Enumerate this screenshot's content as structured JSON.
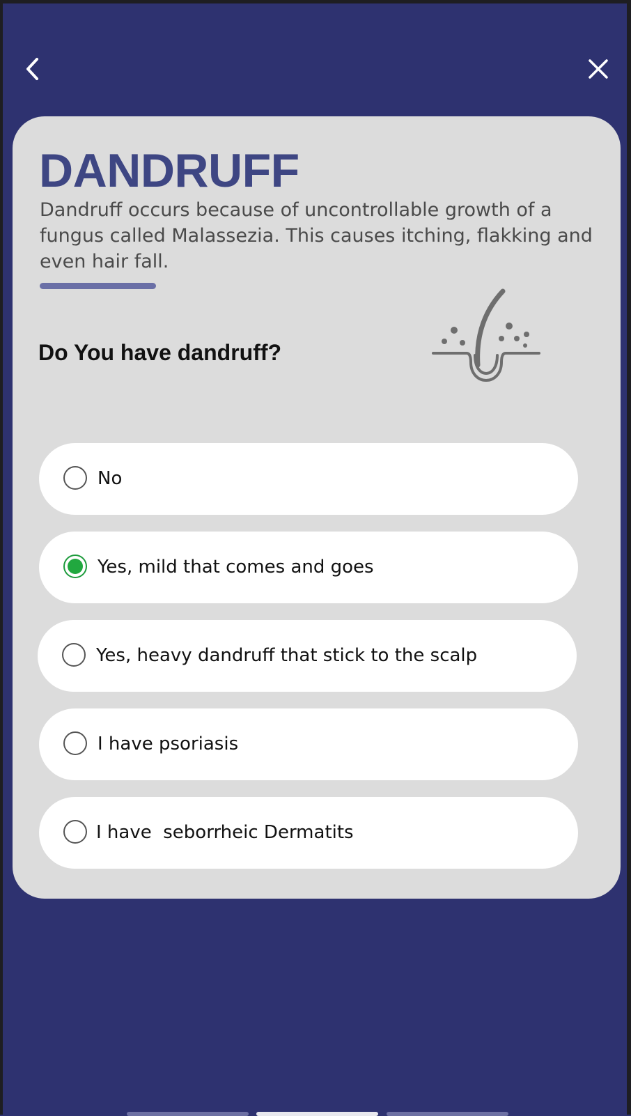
{
  "header": {
    "back_icon": "chevron-left-icon",
    "close_icon": "close-icon"
  },
  "card": {
    "title": "DANDRUFF",
    "description": "Dandruff occurs because of uncontrollable growth of a fungus called Malassezia. This causes itching, flakking and even hair fall.",
    "question": "Do You have dandruff?",
    "illustration_icon": "hair-follicle-icon"
  },
  "options": [
    {
      "label": "No",
      "selected": false
    },
    {
      "label": "Yes, mild that comes and goes",
      "selected": true
    },
    {
      "label": "Yes, heavy dandruff that stick to the scalp",
      "selected": false
    },
    {
      "label": "I have psoriasis",
      "selected": false
    },
    {
      "label": "I have  seborrheic Dermatits",
      "selected": false
    }
  ],
  "pager": {
    "total": 3,
    "active_index": 1
  },
  "colors": {
    "background": "#2e3270",
    "card": "#dcdcdc",
    "title": "#3e4683",
    "selected": "#21a83f"
  }
}
